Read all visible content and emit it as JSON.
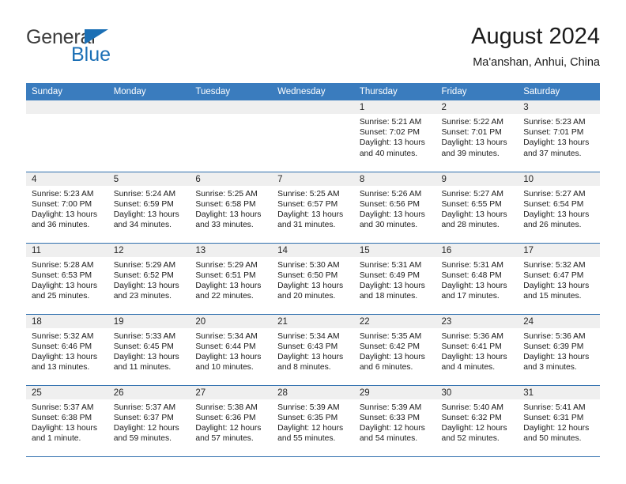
{
  "brand": {
    "name_part1": "General",
    "name_part2": "Blue",
    "triangle_color": "#1b6fb5"
  },
  "header": {
    "title": "August 2024",
    "subtitle": "Ma'anshan, Anhui, China"
  },
  "theme": {
    "header_row_bg": "#3a7cbe",
    "row_divider": "#2f6fae",
    "daynum_band_bg": "#efefef"
  },
  "weekday_headers": [
    "Sunday",
    "Monday",
    "Tuesday",
    "Wednesday",
    "Thursday",
    "Friday",
    "Saturday"
  ],
  "weeks": [
    [
      {
        "day": "",
        "sunrise": "",
        "sunset": "",
        "daylight_line1": "",
        "daylight_line2": ""
      },
      {
        "day": "",
        "sunrise": "",
        "sunset": "",
        "daylight_line1": "",
        "daylight_line2": ""
      },
      {
        "day": "",
        "sunrise": "",
        "sunset": "",
        "daylight_line1": "",
        "daylight_line2": ""
      },
      {
        "day": "",
        "sunrise": "",
        "sunset": "",
        "daylight_line1": "",
        "daylight_line2": ""
      },
      {
        "day": "1",
        "sunrise": "Sunrise: 5:21 AM",
        "sunset": "Sunset: 7:02 PM",
        "daylight_line1": "Daylight: 13 hours",
        "daylight_line2": "and 40 minutes."
      },
      {
        "day": "2",
        "sunrise": "Sunrise: 5:22 AM",
        "sunset": "Sunset: 7:01 PM",
        "daylight_line1": "Daylight: 13 hours",
        "daylight_line2": "and 39 minutes."
      },
      {
        "day": "3",
        "sunrise": "Sunrise: 5:23 AM",
        "sunset": "Sunset: 7:01 PM",
        "daylight_line1": "Daylight: 13 hours",
        "daylight_line2": "and 37 minutes."
      }
    ],
    [
      {
        "day": "4",
        "sunrise": "Sunrise: 5:23 AM",
        "sunset": "Sunset: 7:00 PM",
        "daylight_line1": "Daylight: 13 hours",
        "daylight_line2": "and 36 minutes."
      },
      {
        "day": "5",
        "sunrise": "Sunrise: 5:24 AM",
        "sunset": "Sunset: 6:59 PM",
        "daylight_line1": "Daylight: 13 hours",
        "daylight_line2": "and 34 minutes."
      },
      {
        "day": "6",
        "sunrise": "Sunrise: 5:25 AM",
        "sunset": "Sunset: 6:58 PM",
        "daylight_line1": "Daylight: 13 hours",
        "daylight_line2": "and 33 minutes."
      },
      {
        "day": "7",
        "sunrise": "Sunrise: 5:25 AM",
        "sunset": "Sunset: 6:57 PM",
        "daylight_line1": "Daylight: 13 hours",
        "daylight_line2": "and 31 minutes."
      },
      {
        "day": "8",
        "sunrise": "Sunrise: 5:26 AM",
        "sunset": "Sunset: 6:56 PM",
        "daylight_line1": "Daylight: 13 hours",
        "daylight_line2": "and 30 minutes."
      },
      {
        "day": "9",
        "sunrise": "Sunrise: 5:27 AM",
        "sunset": "Sunset: 6:55 PM",
        "daylight_line1": "Daylight: 13 hours",
        "daylight_line2": "and 28 minutes."
      },
      {
        "day": "10",
        "sunrise": "Sunrise: 5:27 AM",
        "sunset": "Sunset: 6:54 PM",
        "daylight_line1": "Daylight: 13 hours",
        "daylight_line2": "and 26 minutes."
      }
    ],
    [
      {
        "day": "11",
        "sunrise": "Sunrise: 5:28 AM",
        "sunset": "Sunset: 6:53 PM",
        "daylight_line1": "Daylight: 13 hours",
        "daylight_line2": "and 25 minutes."
      },
      {
        "day": "12",
        "sunrise": "Sunrise: 5:29 AM",
        "sunset": "Sunset: 6:52 PM",
        "daylight_line1": "Daylight: 13 hours",
        "daylight_line2": "and 23 minutes."
      },
      {
        "day": "13",
        "sunrise": "Sunrise: 5:29 AM",
        "sunset": "Sunset: 6:51 PM",
        "daylight_line1": "Daylight: 13 hours",
        "daylight_line2": "and 22 minutes."
      },
      {
        "day": "14",
        "sunrise": "Sunrise: 5:30 AM",
        "sunset": "Sunset: 6:50 PM",
        "daylight_line1": "Daylight: 13 hours",
        "daylight_line2": "and 20 minutes."
      },
      {
        "day": "15",
        "sunrise": "Sunrise: 5:31 AM",
        "sunset": "Sunset: 6:49 PM",
        "daylight_line1": "Daylight: 13 hours",
        "daylight_line2": "and 18 minutes."
      },
      {
        "day": "16",
        "sunrise": "Sunrise: 5:31 AM",
        "sunset": "Sunset: 6:48 PM",
        "daylight_line1": "Daylight: 13 hours",
        "daylight_line2": "and 17 minutes."
      },
      {
        "day": "17",
        "sunrise": "Sunrise: 5:32 AM",
        "sunset": "Sunset: 6:47 PM",
        "daylight_line1": "Daylight: 13 hours",
        "daylight_line2": "and 15 minutes."
      }
    ],
    [
      {
        "day": "18",
        "sunrise": "Sunrise: 5:32 AM",
        "sunset": "Sunset: 6:46 PM",
        "daylight_line1": "Daylight: 13 hours",
        "daylight_line2": "and 13 minutes."
      },
      {
        "day": "19",
        "sunrise": "Sunrise: 5:33 AM",
        "sunset": "Sunset: 6:45 PM",
        "daylight_line1": "Daylight: 13 hours",
        "daylight_line2": "and 11 minutes."
      },
      {
        "day": "20",
        "sunrise": "Sunrise: 5:34 AM",
        "sunset": "Sunset: 6:44 PM",
        "daylight_line1": "Daylight: 13 hours",
        "daylight_line2": "and 10 minutes."
      },
      {
        "day": "21",
        "sunrise": "Sunrise: 5:34 AM",
        "sunset": "Sunset: 6:43 PM",
        "daylight_line1": "Daylight: 13 hours",
        "daylight_line2": "and 8 minutes."
      },
      {
        "day": "22",
        "sunrise": "Sunrise: 5:35 AM",
        "sunset": "Sunset: 6:42 PM",
        "daylight_line1": "Daylight: 13 hours",
        "daylight_line2": "and 6 minutes."
      },
      {
        "day": "23",
        "sunrise": "Sunrise: 5:36 AM",
        "sunset": "Sunset: 6:41 PM",
        "daylight_line1": "Daylight: 13 hours",
        "daylight_line2": "and 4 minutes."
      },
      {
        "day": "24",
        "sunrise": "Sunrise: 5:36 AM",
        "sunset": "Sunset: 6:39 PM",
        "daylight_line1": "Daylight: 13 hours",
        "daylight_line2": "and 3 minutes."
      }
    ],
    [
      {
        "day": "25",
        "sunrise": "Sunrise: 5:37 AM",
        "sunset": "Sunset: 6:38 PM",
        "daylight_line1": "Daylight: 13 hours",
        "daylight_line2": "and 1 minute."
      },
      {
        "day": "26",
        "sunrise": "Sunrise: 5:37 AM",
        "sunset": "Sunset: 6:37 PM",
        "daylight_line1": "Daylight: 12 hours",
        "daylight_line2": "and 59 minutes."
      },
      {
        "day": "27",
        "sunrise": "Sunrise: 5:38 AM",
        "sunset": "Sunset: 6:36 PM",
        "daylight_line1": "Daylight: 12 hours",
        "daylight_line2": "and 57 minutes."
      },
      {
        "day": "28",
        "sunrise": "Sunrise: 5:39 AM",
        "sunset": "Sunset: 6:35 PM",
        "daylight_line1": "Daylight: 12 hours",
        "daylight_line2": "and 55 minutes."
      },
      {
        "day": "29",
        "sunrise": "Sunrise: 5:39 AM",
        "sunset": "Sunset: 6:33 PM",
        "daylight_line1": "Daylight: 12 hours",
        "daylight_line2": "and 54 minutes."
      },
      {
        "day": "30",
        "sunrise": "Sunrise: 5:40 AM",
        "sunset": "Sunset: 6:32 PM",
        "daylight_line1": "Daylight: 12 hours",
        "daylight_line2": "and 52 minutes."
      },
      {
        "day": "31",
        "sunrise": "Sunrise: 5:41 AM",
        "sunset": "Sunset: 6:31 PM",
        "daylight_line1": "Daylight: 12 hours",
        "daylight_line2": "and 50 minutes."
      }
    ]
  ]
}
